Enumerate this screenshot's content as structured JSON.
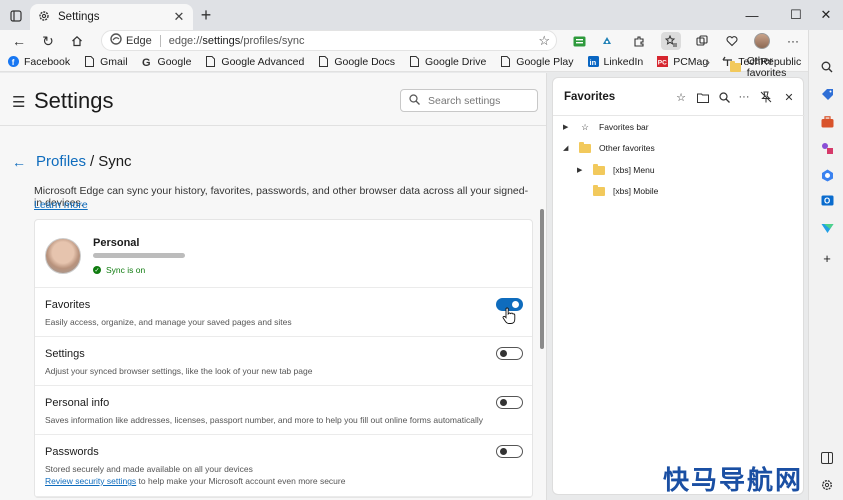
{
  "browser": {
    "tab_title": "Settings",
    "omnibox_label": "Edge",
    "url_prefix": "edge://",
    "url_main": "settings",
    "url_suffix": "/profiles/sync",
    "bookmarks": [
      {
        "label": "Facebook",
        "icon": "facebook-icon"
      },
      {
        "label": "Gmail",
        "icon": "page-icon"
      },
      {
        "label": "Google",
        "icon": "google-icon"
      },
      {
        "label": "Google Advanced",
        "icon": "page-icon"
      },
      {
        "label": "Google Docs",
        "icon": "page-icon"
      },
      {
        "label": "Google Drive",
        "icon": "page-icon"
      },
      {
        "label": "Google Play",
        "icon": "page-icon"
      },
      {
        "label": "LinkedIn",
        "icon": "linkedin-icon"
      },
      {
        "label": "PCMag",
        "icon": "pcmag-icon"
      },
      {
        "label": "TechRepublic",
        "icon": "techrepublic-icon"
      }
    ],
    "other_favorites": "Other favorites"
  },
  "settings": {
    "title": "Settings",
    "search_placeholder": "Search settings",
    "breadcrumb_parent": "Profiles",
    "breadcrumb_sep": "/",
    "breadcrumb_current": "Sync",
    "description": "Microsoft Edge can sync your history, favorites, passwords, and other browser data across all your signed-in devices.",
    "learn_more": "Learn more",
    "profile": {
      "name": "Personal",
      "sync_status": "Sync is on"
    },
    "rows": [
      {
        "label": "Favorites",
        "help": "Easily access, organize, and manage your saved pages and sites",
        "on": true
      },
      {
        "label": "Settings",
        "help": "Adjust your synced browser settings, like the look of your new tab page",
        "on": false
      },
      {
        "label": "Personal info",
        "help": "Saves information like addresses, licenses, passport number, and more to help you fill out online forms automatically",
        "on": false
      },
      {
        "label": "Passwords",
        "help": "Stored securely and made available on all your devices",
        "help_link": "Review security settings",
        "help_tail": " to help make your Microsoft account even more secure",
        "on": false
      }
    ]
  },
  "favorites_pane": {
    "title": "Favorites",
    "items": [
      {
        "label": "Favorites bar",
        "arrow": "▶",
        "icon": "star-icon"
      },
      {
        "label": "Other favorites",
        "arrow": "◢",
        "icon": "folder-icon"
      },
      {
        "label": "[xbs] Menu",
        "arrow": "▶",
        "icon": "folder-icon"
      },
      {
        "label": "[xbs] Mobile",
        "arrow": "",
        "icon": "folder-icon"
      }
    ]
  },
  "watermark": "快马导航网",
  "colors": {
    "accent": "#0f6cbd",
    "sync_green": "#107c10"
  }
}
